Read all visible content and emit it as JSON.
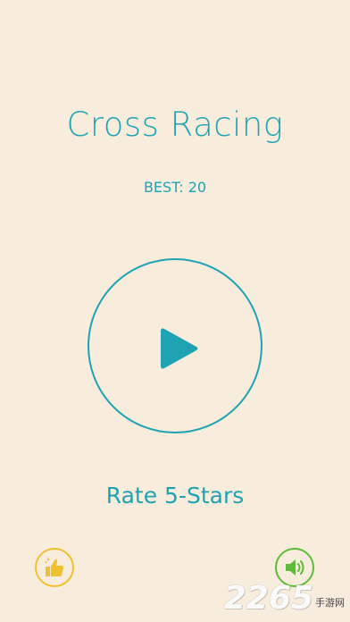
{
  "game": {
    "title": "Cross Racing",
    "best_label": "BEST: 20",
    "rate_label": "Rate 5-Stars"
  },
  "buttons": {
    "play_icon": "play-icon",
    "like_icon": "thumbs-up-icon",
    "sound_icon": "speaker-icon"
  },
  "watermark": {
    "number": "2265",
    "text": "手游网"
  },
  "colors": {
    "background": "#f8ecdc",
    "accent": "#1fa3b3",
    "like": "#f0c02e",
    "sound": "#5fb93a"
  }
}
